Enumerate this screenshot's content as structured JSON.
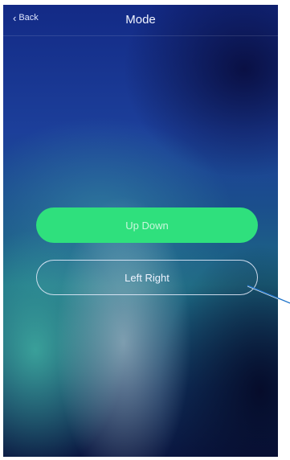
{
  "header": {
    "back_label": "Back",
    "title": "Mode"
  },
  "options": {
    "up_down_label": "Up Down",
    "left_right_label": "Left Right"
  },
  "colors": {
    "primary_button": "#2fe07d",
    "pointer_line": "#1e73c9"
  },
  "icons": {
    "back": "chevron-left-icon"
  }
}
